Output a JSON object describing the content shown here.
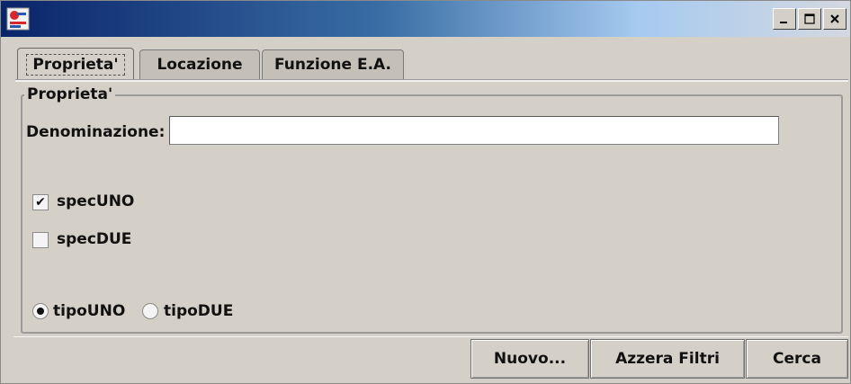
{
  "window": {
    "title": "",
    "buttons": [
      "_",
      "□",
      "×"
    ]
  },
  "tabs": [
    {
      "label": "Proprieta'",
      "active": true
    },
    {
      "label": "Locazione",
      "active": false
    },
    {
      "label": "Funzione E.A.",
      "active": false
    }
  ],
  "group": {
    "title": "Proprieta'"
  },
  "denominazione": {
    "label": "Denominazione:",
    "value": ""
  },
  "checkboxes": [
    {
      "label": "specUNO",
      "checked": true
    },
    {
      "label": "specDUE",
      "checked": false
    }
  ],
  "radios": [
    {
      "label": "tipoUNO",
      "selected": true
    },
    {
      "label": "tipoDUE",
      "selected": false
    }
  ],
  "actions": {
    "nuovo": "Nuovo...",
    "azzera": "Azzera Filtri",
    "cerca": "Cerca"
  },
  "icons": {
    "minimize": "minimize-icon",
    "maximize": "maximize-icon",
    "close": "close-icon",
    "app": "app-logo-icon",
    "check": "checkmark-icon"
  }
}
